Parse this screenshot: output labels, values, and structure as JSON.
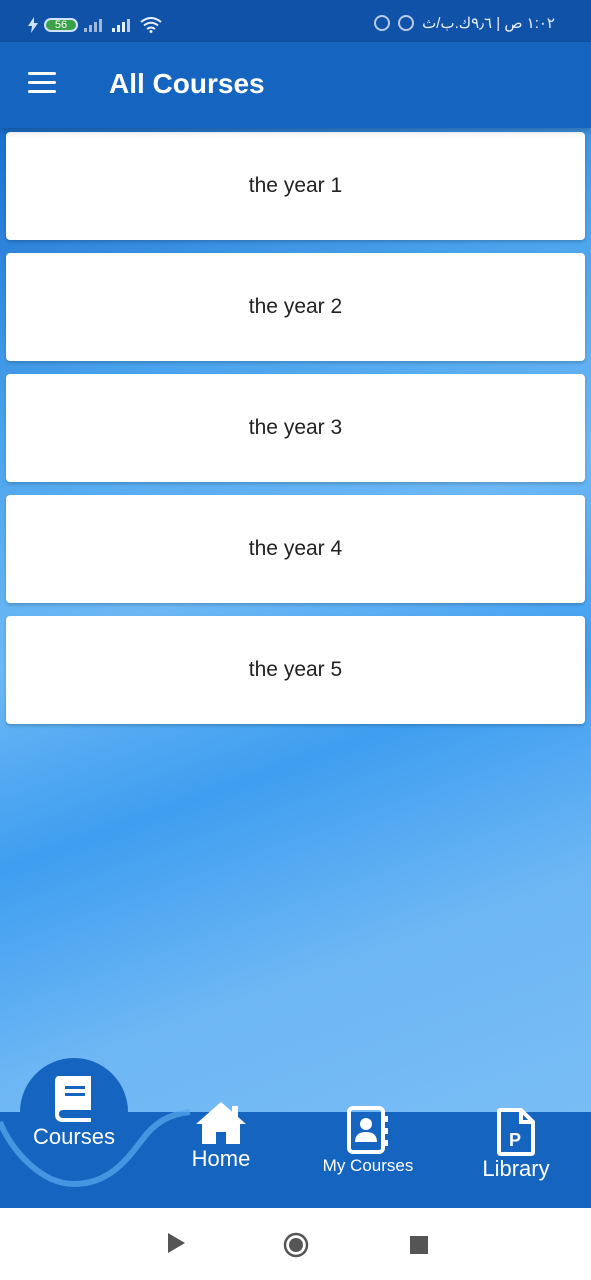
{
  "status_bar": {
    "battery": "56",
    "right_text": "١:٠٢ ص | ٩٫٦ك.ب/ث"
  },
  "app_bar": {
    "title": "All Courses"
  },
  "courses": [
    {
      "label": "the year 1"
    },
    {
      "label": "the year 2"
    },
    {
      "label": "the year 3"
    },
    {
      "label": "the year 4"
    },
    {
      "label": "the year 5"
    }
  ],
  "bottom_nav": {
    "courses": "Courses",
    "home": "Home",
    "my_courses": "My Courses",
    "library": "Library"
  },
  "colors": {
    "primary": "#1565c0",
    "status_bar": "#0f52a8",
    "card": "#ffffff"
  },
  "icons": {
    "menu": "menu-icon",
    "courses": "book-icon",
    "home": "home-icon",
    "my_courses": "contact-book-icon",
    "library": "pdf-file-icon"
  }
}
